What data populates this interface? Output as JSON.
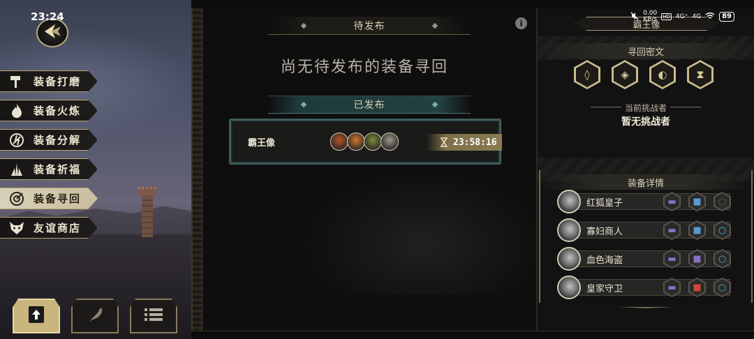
{
  "status_bar": {
    "time": "23:24",
    "net_speed_value": "0.00",
    "net_speed_unit": "KB/s",
    "hd": "HD",
    "signal1": "4G⁺",
    "signal2": "4G",
    "battery": "89"
  },
  "menu": {
    "items": [
      {
        "label": "装备打磨",
        "icon": "hammer-icon",
        "active": false
      },
      {
        "label": "装备火炼",
        "icon": "flame-icon",
        "active": false
      },
      {
        "label": "装备分解",
        "icon": "decompose-icon",
        "active": false
      },
      {
        "label": "装备祈福",
        "icon": "pray-icon",
        "active": false
      },
      {
        "label": "装备寻回",
        "icon": "target-icon",
        "active": true
      },
      {
        "label": "友谊商店",
        "icon": "fox-mask-icon",
        "active": false
      }
    ]
  },
  "bottom_tabs": [
    {
      "icon": "upload-icon",
      "active": true
    },
    {
      "icon": "feather-icon",
      "active": false
    },
    {
      "icon": "list-icon",
      "active": false
    }
  ],
  "center": {
    "pending_title": "待发布",
    "pending_empty": "尚无待发布的装备寻回",
    "published_title": "已发布",
    "info_glyph": "i",
    "published_items": [
      {
        "name": "霸王像",
        "timer": "23:58:16",
        "avatar_colors": [
          "#b4542a",
          "#d07a2e",
          "#7a8a3a",
          "#9a9a90"
        ]
      }
    ]
  },
  "right": {
    "title": "霸王像",
    "cipher_title": "寻回密文",
    "cipher_symbols": [
      "◊",
      "◈",
      "◐",
      "⧗"
    ],
    "challenger_label": "当前挑战者",
    "challenger_value": "暂无挑战者",
    "detail_title": "装备详情",
    "equipment": [
      {
        "name": "红狐皇子",
        "slots": [
          "#8a6fc8",
          "#5a9ad0",
          "#5a5750"
        ]
      },
      {
        "name": "寡妇商人",
        "slots": [
          "#8a6fc8",
          "#5a9ad0",
          "#4ab0d8"
        ]
      },
      {
        "name": "血色海盗",
        "slots": [
          "#8a6fc8",
          "#8a6fc8",
          "#4ab0d8"
        ]
      },
      {
        "name": "皇家守卫",
        "slots": [
          "#8a6fc8",
          "#c8483c",
          "#4ab0d8"
        ]
      }
    ]
  },
  "colors": {
    "gold_border": "#b9a670",
    "teal_accent": "#3f5e5c",
    "panel_bg": "#121212"
  }
}
